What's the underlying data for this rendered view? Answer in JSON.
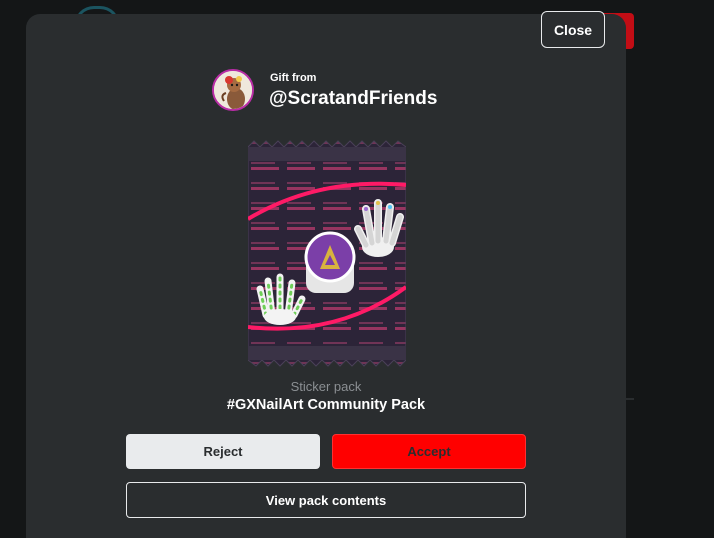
{
  "modal": {
    "close_label": "Close",
    "gift_from_label": "Gift from",
    "sender_handle": "@ScratandFriends",
    "pack_type": "Sticker pack",
    "pack_name": "#GXNailArt Community Pack",
    "reject_label": "Reject",
    "accept_label": "Accept",
    "view_contents_label": "View pack contents"
  },
  "pack_art": {
    "sticker_text_top": "#GXNailArt",
    "sticker_text_bottom": "CONTEST"
  },
  "colors": {
    "modal_bg": "#2a2d2f",
    "accept": "#ff0000",
    "reject": "#e9ebed",
    "accent_pink": "#ff1a66",
    "pack_bg": "#2c2438"
  },
  "icons": {
    "avatar": "user-avatar",
    "pack": "sticker-pack-image"
  }
}
